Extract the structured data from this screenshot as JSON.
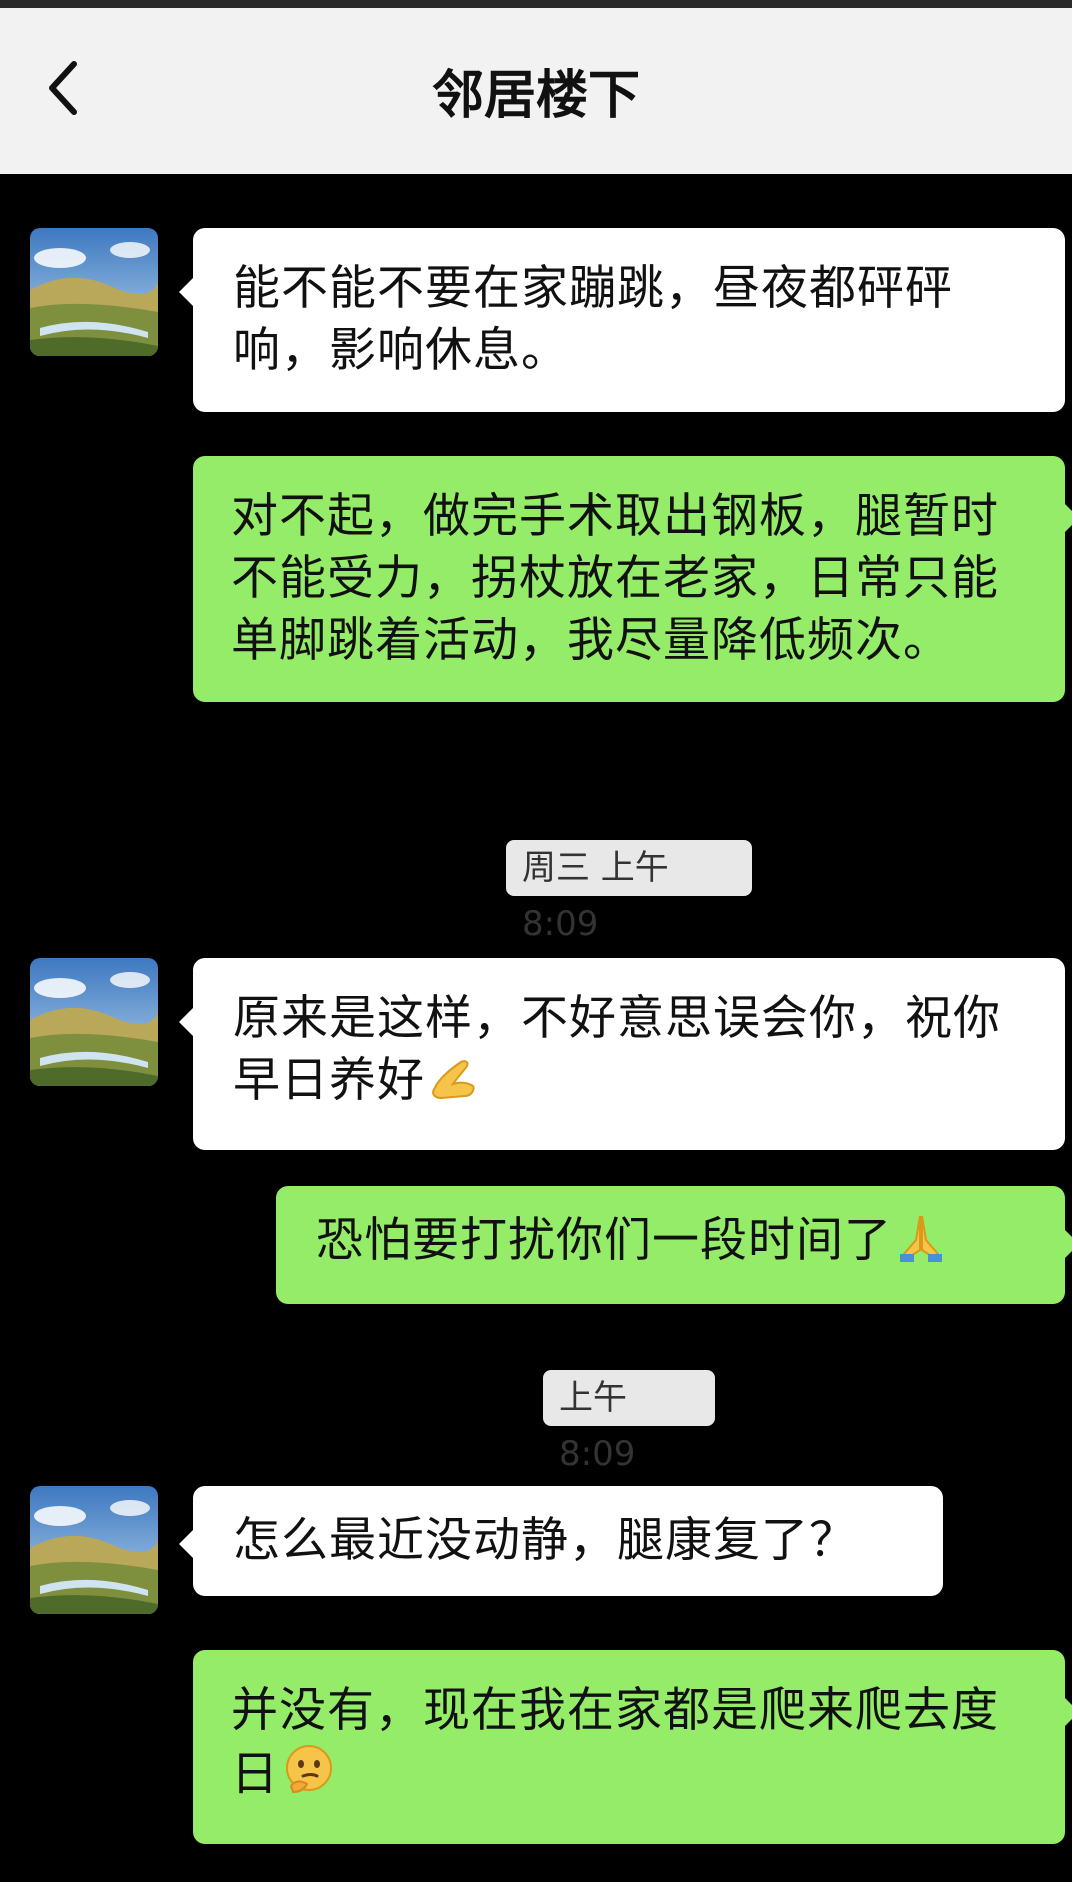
{
  "header": {
    "title": "邻居楼下",
    "back_icon": "chevron-left-icon"
  },
  "messages": [
    {
      "side": "in",
      "text": "能不能不要在家蹦跳，昼夜都砰砰响，影响休息。"
    },
    {
      "side": "out",
      "text": "对不起，做完手术取出钢板，腿暂时不能受力，拐杖放在老家，日常只能单脚跳着活动，我尽量降低频次。"
    },
    {
      "side": "in",
      "text": "原来是这样，不好意思误会你，祝你早日养好",
      "emoji": "ok-hand-icon"
    },
    {
      "side": "out",
      "text": "恐怕要打扰你们一段时间了",
      "emoji": "folded-hands-icon"
    },
    {
      "side": "in",
      "text": "怎么最近没动静，腿康复了？"
    },
    {
      "side": "out",
      "text": "并没有，现在我在家都是爬来爬去度日",
      "emoji": "thinking-face-icon"
    }
  ],
  "timestamps": [
    "周三 上午8:09",
    "上午8:09"
  ],
  "colors": {
    "outgoing_bubble": "#95ec69",
    "incoming_bubble": "#ffffff",
    "chat_background": "#000000",
    "header_background": "#f2f2f2"
  }
}
